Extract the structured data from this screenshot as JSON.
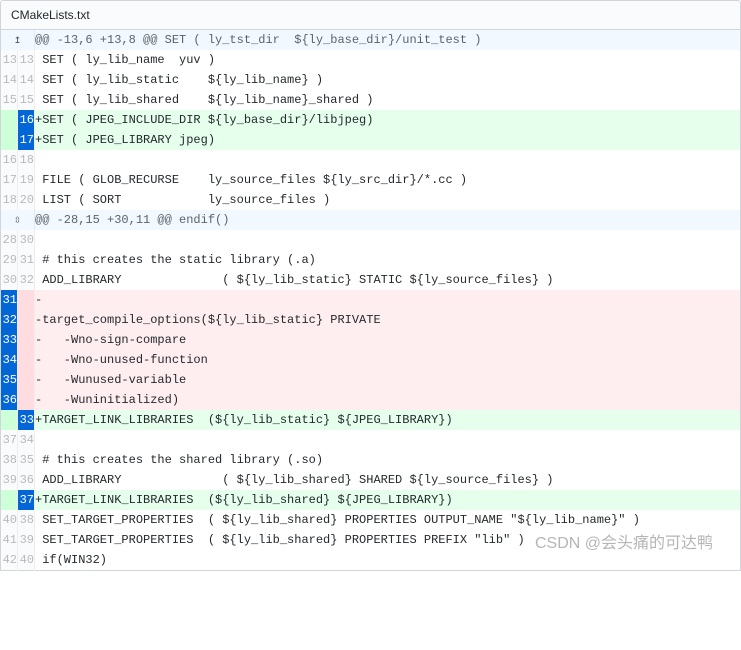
{
  "file": {
    "name": "CMakeLists.txt"
  },
  "hunks": [
    {
      "type": "hunk",
      "header": "@@ -13,6 +13,8 @@ SET ( ly_tst_dir  ${ly_base_dir}/unit_test )",
      "expand": "up"
    },
    {
      "type": "ctx",
      "old": "13",
      "new": "13",
      "code": " SET ( ly_lib_name  yuv )"
    },
    {
      "type": "ctx",
      "old": "14",
      "new": "14",
      "code": " SET ( ly_lib_static    ${ly_lib_name} )"
    },
    {
      "type": "ctx",
      "old": "15",
      "new": "15",
      "code": " SET ( ly_lib_shared    ${ly_lib_name}_shared )"
    },
    {
      "type": "add",
      "old": "",
      "new": "16",
      "code": "+SET ( JPEG_INCLUDE_DIR ${ly_base_dir}/libjpeg)",
      "selNew": true
    },
    {
      "type": "add",
      "old": "",
      "new": "17",
      "code": "+SET ( JPEG_LIBRARY jpeg)",
      "selNew": true
    },
    {
      "type": "ctx",
      "old": "16",
      "new": "18",
      "code": ""
    },
    {
      "type": "ctx",
      "old": "17",
      "new": "19",
      "code": " FILE ( GLOB_RECURSE    ly_source_files ${ly_src_dir}/*.cc )"
    },
    {
      "type": "ctx",
      "old": "18",
      "new": "20",
      "code": " LIST ( SORT            ly_source_files )"
    },
    {
      "type": "hunk",
      "header": "@@ -28,15 +30,11 @@ endif()",
      "expand": "both"
    },
    {
      "type": "ctx",
      "old": "28",
      "new": "30",
      "code": ""
    },
    {
      "type": "ctx",
      "old": "29",
      "new": "31",
      "code": " # this creates the static library (.a)"
    },
    {
      "type": "ctx",
      "old": "30",
      "new": "32",
      "code": " ADD_LIBRARY              ( ${ly_lib_static} STATIC ${ly_source_files} )"
    },
    {
      "type": "del",
      "old": "31",
      "new": "",
      "code": "-",
      "selOld": true
    },
    {
      "type": "del",
      "old": "32",
      "new": "",
      "code": "-target_compile_options(${ly_lib_static} PRIVATE",
      "selOld": true
    },
    {
      "type": "del",
      "old": "33",
      "new": "",
      "code": "-   -Wno-sign-compare",
      "selOld": true
    },
    {
      "type": "del",
      "old": "34",
      "new": "",
      "code": "-   -Wno-unused-function",
      "selOld": true
    },
    {
      "type": "del",
      "old": "35",
      "new": "",
      "code": "-   -Wunused-variable",
      "selOld": true
    },
    {
      "type": "del",
      "old": "36",
      "new": "",
      "code": "-   -Wuninitialized)",
      "selOld": true
    },
    {
      "type": "add",
      "old": "",
      "new": "33",
      "code": "+TARGET_LINK_LIBRARIES  (${ly_lib_static} ${JPEG_LIBRARY})",
      "selNew": true
    },
    {
      "type": "ctx",
      "old": "37",
      "new": "34",
      "code": ""
    },
    {
      "type": "ctx",
      "old": "38",
      "new": "35",
      "code": " # this creates the shared library (.so)"
    },
    {
      "type": "ctx",
      "old": "39",
      "new": "36",
      "code": " ADD_LIBRARY              ( ${ly_lib_shared} SHARED ${ly_source_files} )"
    },
    {
      "type": "add",
      "old": "",
      "new": "37",
      "code": "+TARGET_LINK_LIBRARIES  (${ly_lib_shared} ${JPEG_LIBRARY})",
      "selNew": true
    },
    {
      "type": "ctx",
      "old": "40",
      "new": "38",
      "code": " SET_TARGET_PROPERTIES  ( ${ly_lib_shared} PROPERTIES OUTPUT_NAME \"${ly_lib_name}\" )"
    },
    {
      "type": "ctx",
      "old": "41",
      "new": "39",
      "code": " SET_TARGET_PROPERTIES  ( ${ly_lib_shared} PROPERTIES PREFIX \"lib\" )"
    },
    {
      "type": "ctx",
      "old": "42",
      "new": "40",
      "code": " if(WIN32)"
    }
  ],
  "watermark": "CSDN @会头痛的可达鸭",
  "icons": {
    "expand_up": "↥",
    "expand_both": "⇳"
  }
}
